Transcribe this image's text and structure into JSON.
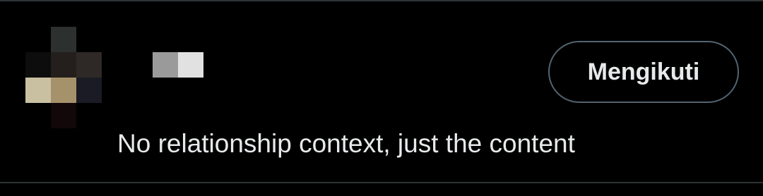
{
  "colors": {
    "background": "#000000",
    "divider": "#2f3336",
    "text_primary": "#e7e9ea",
    "button_border": "#536471"
  },
  "user_cell": {
    "follow_button_label": "Mengikuti",
    "bio": "No relationship context, just the content"
  }
}
